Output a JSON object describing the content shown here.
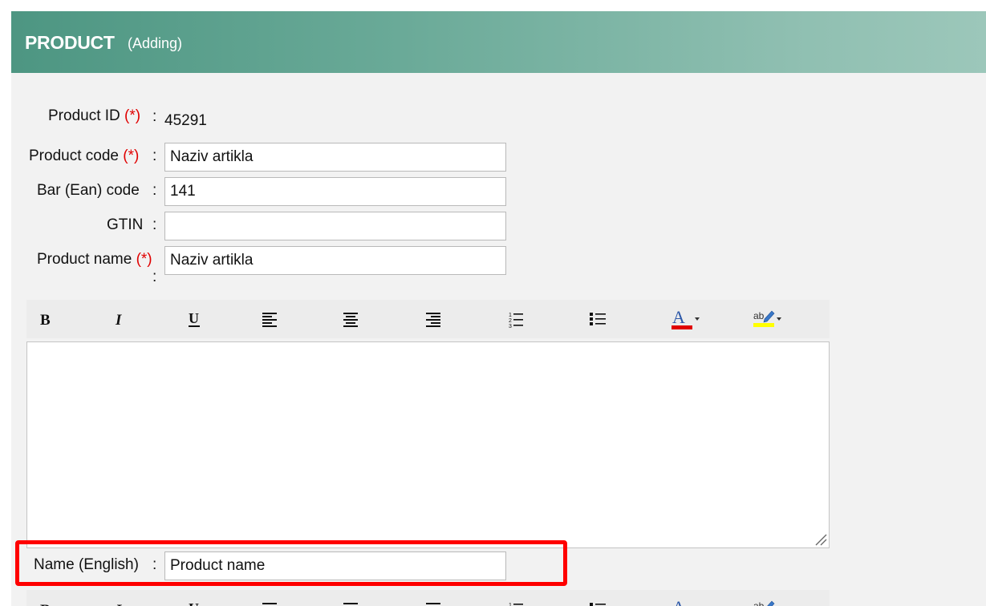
{
  "header": {
    "title": "PRODUCT",
    "subtitle": "(Adding)"
  },
  "form": {
    "required_mark": "(*)",
    "colon": ":",
    "product_id": {
      "label": "Product ID",
      "value": "45291"
    },
    "product_code": {
      "label": "Product code",
      "value": "Naziv artikla"
    },
    "bar_code": {
      "label": "Bar (Ean) code",
      "value": "141"
    },
    "gtin": {
      "label": "GTIN",
      "value": ""
    },
    "product_name": {
      "label": "Product name",
      "value": "Naziv artikla"
    },
    "name_english": {
      "label": "Name (English)",
      "value": "Product name"
    }
  },
  "toolbar": {
    "buttons": [
      "bold-icon",
      "italic-icon",
      "underline-icon",
      "align-left-icon",
      "align-center-icon",
      "align-right-icon",
      "numbered-list-icon",
      "bullet-list-icon",
      "font-color-icon",
      "highlight-color-icon"
    ],
    "bold_glyph": "B",
    "italic_glyph": "I",
    "underline_glyph": "U",
    "font_color_glyph": "A",
    "highlight_glyph": "ab",
    "font_color": "#e00000",
    "highlight_color": "#ffff00"
  },
  "editor": {
    "content": ""
  }
}
